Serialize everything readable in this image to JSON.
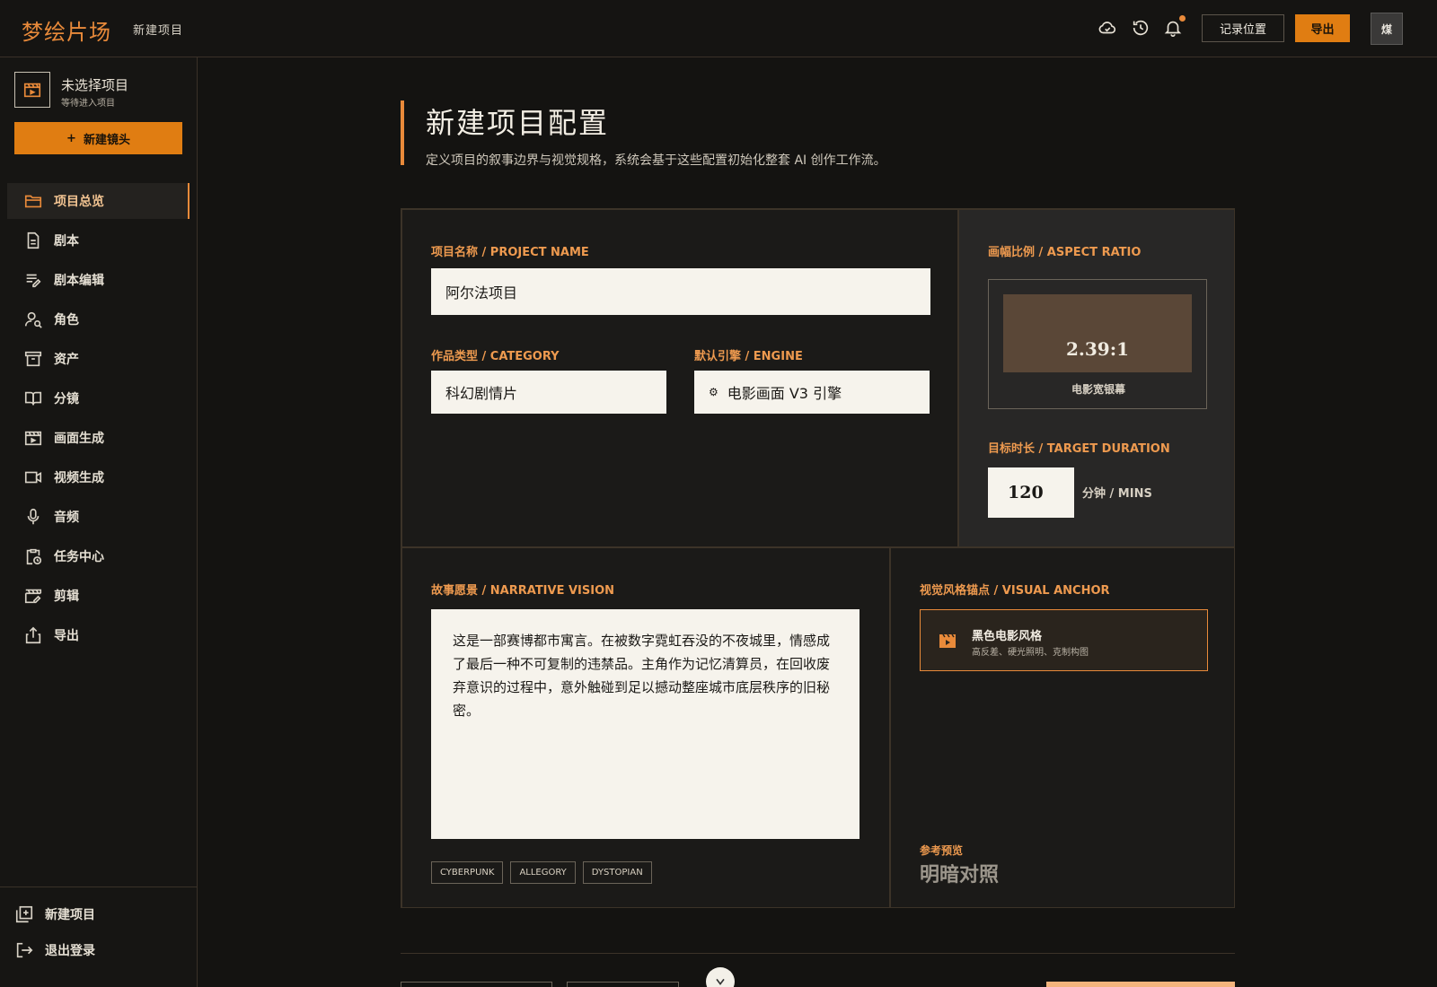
{
  "header": {
    "brand": "梦绘片场",
    "breadcrumb": "新建项目",
    "record_position_label": "记录位置",
    "export_label": "导出",
    "avatar_text": "煤",
    "icons": [
      "cloud-check-icon",
      "history-icon",
      "bell-icon"
    ]
  },
  "sidebar": {
    "project_title": "未选择项目",
    "project_subtitle": "等待进入项目",
    "new_shot_label": "新建镜头",
    "items": [
      {
        "label": "项目总览",
        "icon": "folder-icon",
        "active": true
      },
      {
        "label": "剧本",
        "icon": "document-icon"
      },
      {
        "label": "剧本编辑",
        "icon": "edit-lines-icon"
      },
      {
        "label": "角色",
        "icon": "person-search-icon"
      },
      {
        "label": "资产",
        "icon": "archive-icon"
      },
      {
        "label": "分镜",
        "icon": "book-open-icon"
      },
      {
        "label": "画面生成",
        "icon": "film-icon"
      },
      {
        "label": "视频生成",
        "icon": "video-camera-icon"
      },
      {
        "label": "音频",
        "icon": "microphone-icon"
      },
      {
        "label": "任务中心",
        "icon": "clipboard-clock-icon"
      },
      {
        "label": "剪辑",
        "icon": "clapperboard-edit-icon"
      },
      {
        "label": "导出",
        "icon": "share-icon"
      }
    ],
    "bottom": [
      {
        "label": "新建项目",
        "icon": "add-box-icon"
      },
      {
        "label": "退出登录",
        "icon": "logout-icon"
      }
    ]
  },
  "main": {
    "title": "新建项目配置",
    "description": "定义项目的叙事边界与视觉规格，系统会基于这些配置初始化整套 AI 创作工作流。",
    "project_name": {
      "label": "项目名称 / PROJECT NAME",
      "value": "阿尔法项目"
    },
    "category": {
      "label": "作品类型 / CATEGORY",
      "value": "科幻剧情片"
    },
    "engine": {
      "label": "默认引擎 / ENGINE",
      "value": "电影画面 V3 引擎",
      "icon": "engine-icon"
    },
    "aspect_ratio": {
      "label": "画幅比例 / ASPECT RATIO",
      "value": "2.39:1",
      "caption": "电影宽银幕"
    },
    "duration": {
      "label": "目标时长 / TARGET DURATION",
      "value": "120",
      "unit": "分钟 / MINS"
    },
    "narrative": {
      "label": "故事愿景 / NARRATIVE VISION",
      "text": "这是一部赛博都市寓言。在被数字霓虹吞没的不夜城里，情感成了最后一种不可复制的违禁品。主角作为记忆清算员，在回收废弃意识的过程中，意外触碰到足以撼动整座城市底层秩序的旧秘密。",
      "tags": [
        "CYBERPUNK",
        "ALLEGORY",
        "DYSTOPIAN"
      ]
    },
    "visual_anchor": {
      "label": "视觉风格锚点 / VISUAL ANCHOR",
      "title": "黑色电影风格",
      "subtitle": "高反差、硬光照明、克制构图",
      "reference_label": "参考预览",
      "reference_value": "明暗对照"
    }
  },
  "colors": {
    "accent": "#e07d12",
    "accent_light": "#ee9a4f",
    "background": "#141311",
    "panel": "#1b1a18"
  }
}
